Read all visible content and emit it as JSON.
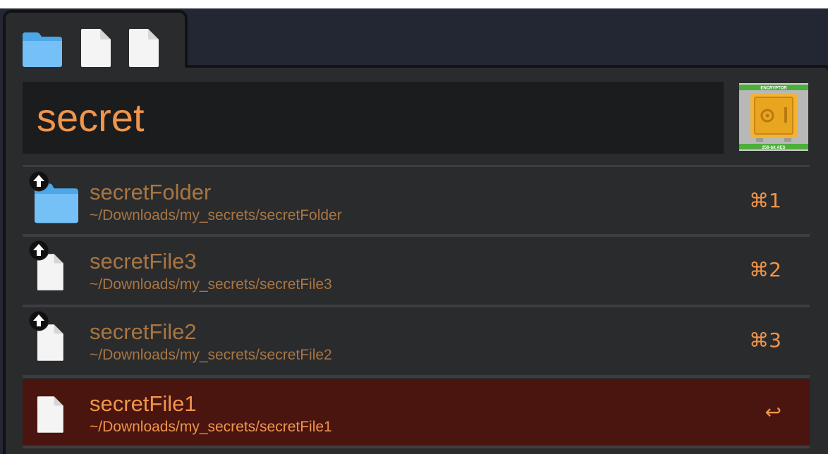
{
  "search": {
    "query": "secret"
  },
  "buffer": {
    "items": [
      "folder-icon",
      "document-icon",
      "document-icon"
    ]
  },
  "action": {
    "name": "Encryptor",
    "icon": "safe-icon",
    "icon_text_top": "ENCRYPTOR",
    "icon_text_bottom": "256-bit AES"
  },
  "results": [
    {
      "name": "secretFolder",
      "path": "~/Downloads/my_secrets/secretFolder",
      "shortcut": "⌘1",
      "icon": "folder-icon",
      "badge": "upload-arrow-badge-icon",
      "selected": false
    },
    {
      "name": "secretFile3",
      "path": "~/Downloads/my_secrets/secretFile3",
      "shortcut": "⌘2",
      "icon": "document-icon",
      "badge": "upload-arrow-badge-icon",
      "selected": false
    },
    {
      "name": "secretFile2",
      "path": "~/Downloads/my_secrets/secretFile2",
      "shortcut": "⌘3",
      "icon": "document-icon",
      "badge": "upload-arrow-badge-icon",
      "selected": false
    },
    {
      "name": "secretFile1",
      "path": "~/Downloads/my_secrets/secretFile1",
      "shortcut": "↩",
      "icon": "document-icon",
      "badge": null,
      "selected": true
    }
  ],
  "colors": {
    "accent": "#f0954b",
    "dim_text": "#a97542",
    "panel_bg": "#2a2b2d",
    "field_bg": "#1b1c1d",
    "selected_bg": "#4a150f",
    "window_bg": "#232733"
  }
}
